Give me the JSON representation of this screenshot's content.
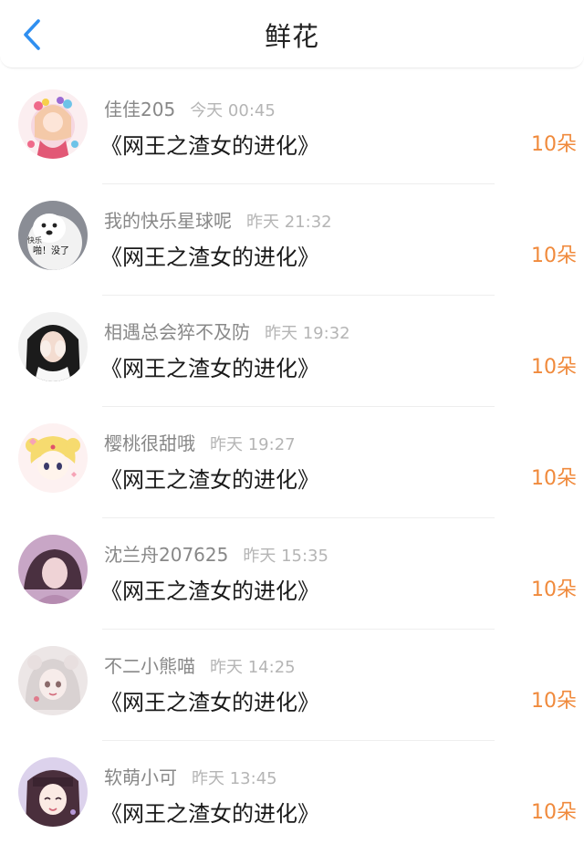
{
  "header": {
    "title": "鲜花",
    "back_icon": "chevron-left-icon",
    "accent": "#2f8ff0"
  },
  "colors": {
    "count": "#f08a3c",
    "username": "#888888",
    "time": "#b5b5b5"
  },
  "items": [
    {
      "username": "佳佳205",
      "time": "今天 00:45",
      "book": "《网王之渣女的进化》",
      "count": "10朵",
      "avatar": "avatar-icon"
    },
    {
      "username": "我的快乐星球呢",
      "time": "昨天 21:32",
      "book": "《网王之渣女的进化》",
      "count": "10朵",
      "avatar": "avatar-icon",
      "avatar_text_1": "快乐",
      "avatar_text_2": "啪！没了"
    },
    {
      "username": "相遇总会猝不及防",
      "time": "昨天 19:32",
      "book": "《网王之渣女的进化》",
      "count": "10朵",
      "avatar": "avatar-icon"
    },
    {
      "username": "樱桃很甜哦",
      "time": "昨天 19:27",
      "book": "《网王之渣女的进化》",
      "count": "10朵",
      "avatar": "avatar-icon"
    },
    {
      "username": "沈兰舟207625",
      "time": "昨天 15:35",
      "book": "《网王之渣女的进化》",
      "count": "10朵",
      "avatar": "avatar-icon"
    },
    {
      "username": "不二小熊喵",
      "time": "昨天 14:25",
      "book": "《网王之渣女的进化》",
      "count": "10朵",
      "avatar": "avatar-icon"
    },
    {
      "username": "软萌小可",
      "time": "昨天 13:45",
      "book": "《网王之渣女的进化》",
      "count": "10朵",
      "avatar": "avatar-icon"
    }
  ]
}
